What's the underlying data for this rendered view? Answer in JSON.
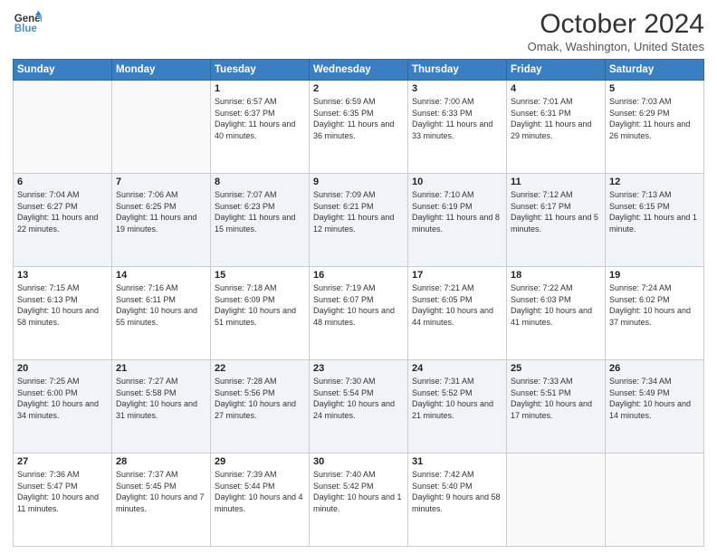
{
  "header": {
    "logo_line1": "General",
    "logo_line2": "Blue",
    "month": "October 2024",
    "location": "Omak, Washington, United States"
  },
  "weekdays": [
    "Sunday",
    "Monday",
    "Tuesday",
    "Wednesday",
    "Thursday",
    "Friday",
    "Saturday"
  ],
  "weeks": [
    [
      {
        "day": "",
        "info": ""
      },
      {
        "day": "",
        "info": ""
      },
      {
        "day": "1",
        "info": "Sunrise: 6:57 AM\nSunset: 6:37 PM\nDaylight: 11 hours and 40 minutes."
      },
      {
        "day": "2",
        "info": "Sunrise: 6:59 AM\nSunset: 6:35 PM\nDaylight: 11 hours and 36 minutes."
      },
      {
        "day": "3",
        "info": "Sunrise: 7:00 AM\nSunset: 6:33 PM\nDaylight: 11 hours and 33 minutes."
      },
      {
        "day": "4",
        "info": "Sunrise: 7:01 AM\nSunset: 6:31 PM\nDaylight: 11 hours and 29 minutes."
      },
      {
        "day": "5",
        "info": "Sunrise: 7:03 AM\nSunset: 6:29 PM\nDaylight: 11 hours and 26 minutes."
      }
    ],
    [
      {
        "day": "6",
        "info": "Sunrise: 7:04 AM\nSunset: 6:27 PM\nDaylight: 11 hours and 22 minutes."
      },
      {
        "day": "7",
        "info": "Sunrise: 7:06 AM\nSunset: 6:25 PM\nDaylight: 11 hours and 19 minutes."
      },
      {
        "day": "8",
        "info": "Sunrise: 7:07 AM\nSunset: 6:23 PM\nDaylight: 11 hours and 15 minutes."
      },
      {
        "day": "9",
        "info": "Sunrise: 7:09 AM\nSunset: 6:21 PM\nDaylight: 11 hours and 12 minutes."
      },
      {
        "day": "10",
        "info": "Sunrise: 7:10 AM\nSunset: 6:19 PM\nDaylight: 11 hours and 8 minutes."
      },
      {
        "day": "11",
        "info": "Sunrise: 7:12 AM\nSunset: 6:17 PM\nDaylight: 11 hours and 5 minutes."
      },
      {
        "day": "12",
        "info": "Sunrise: 7:13 AM\nSunset: 6:15 PM\nDaylight: 11 hours and 1 minute."
      }
    ],
    [
      {
        "day": "13",
        "info": "Sunrise: 7:15 AM\nSunset: 6:13 PM\nDaylight: 10 hours and 58 minutes."
      },
      {
        "day": "14",
        "info": "Sunrise: 7:16 AM\nSunset: 6:11 PM\nDaylight: 10 hours and 55 minutes."
      },
      {
        "day": "15",
        "info": "Sunrise: 7:18 AM\nSunset: 6:09 PM\nDaylight: 10 hours and 51 minutes."
      },
      {
        "day": "16",
        "info": "Sunrise: 7:19 AM\nSunset: 6:07 PM\nDaylight: 10 hours and 48 minutes."
      },
      {
        "day": "17",
        "info": "Sunrise: 7:21 AM\nSunset: 6:05 PM\nDaylight: 10 hours and 44 minutes."
      },
      {
        "day": "18",
        "info": "Sunrise: 7:22 AM\nSunset: 6:03 PM\nDaylight: 10 hours and 41 minutes."
      },
      {
        "day": "19",
        "info": "Sunrise: 7:24 AM\nSunset: 6:02 PM\nDaylight: 10 hours and 37 minutes."
      }
    ],
    [
      {
        "day": "20",
        "info": "Sunrise: 7:25 AM\nSunset: 6:00 PM\nDaylight: 10 hours and 34 minutes."
      },
      {
        "day": "21",
        "info": "Sunrise: 7:27 AM\nSunset: 5:58 PM\nDaylight: 10 hours and 31 minutes."
      },
      {
        "day": "22",
        "info": "Sunrise: 7:28 AM\nSunset: 5:56 PM\nDaylight: 10 hours and 27 minutes."
      },
      {
        "day": "23",
        "info": "Sunrise: 7:30 AM\nSunset: 5:54 PM\nDaylight: 10 hours and 24 minutes."
      },
      {
        "day": "24",
        "info": "Sunrise: 7:31 AM\nSunset: 5:52 PM\nDaylight: 10 hours and 21 minutes."
      },
      {
        "day": "25",
        "info": "Sunrise: 7:33 AM\nSunset: 5:51 PM\nDaylight: 10 hours and 17 minutes."
      },
      {
        "day": "26",
        "info": "Sunrise: 7:34 AM\nSunset: 5:49 PM\nDaylight: 10 hours and 14 minutes."
      }
    ],
    [
      {
        "day": "27",
        "info": "Sunrise: 7:36 AM\nSunset: 5:47 PM\nDaylight: 10 hours and 11 minutes."
      },
      {
        "day": "28",
        "info": "Sunrise: 7:37 AM\nSunset: 5:45 PM\nDaylight: 10 hours and 7 minutes."
      },
      {
        "day": "29",
        "info": "Sunrise: 7:39 AM\nSunset: 5:44 PM\nDaylight: 10 hours and 4 minutes."
      },
      {
        "day": "30",
        "info": "Sunrise: 7:40 AM\nSunset: 5:42 PM\nDaylight: 10 hours and 1 minute."
      },
      {
        "day": "31",
        "info": "Sunrise: 7:42 AM\nSunset: 5:40 PM\nDaylight: 9 hours and 58 minutes."
      },
      {
        "day": "",
        "info": ""
      },
      {
        "day": "",
        "info": ""
      }
    ]
  ]
}
